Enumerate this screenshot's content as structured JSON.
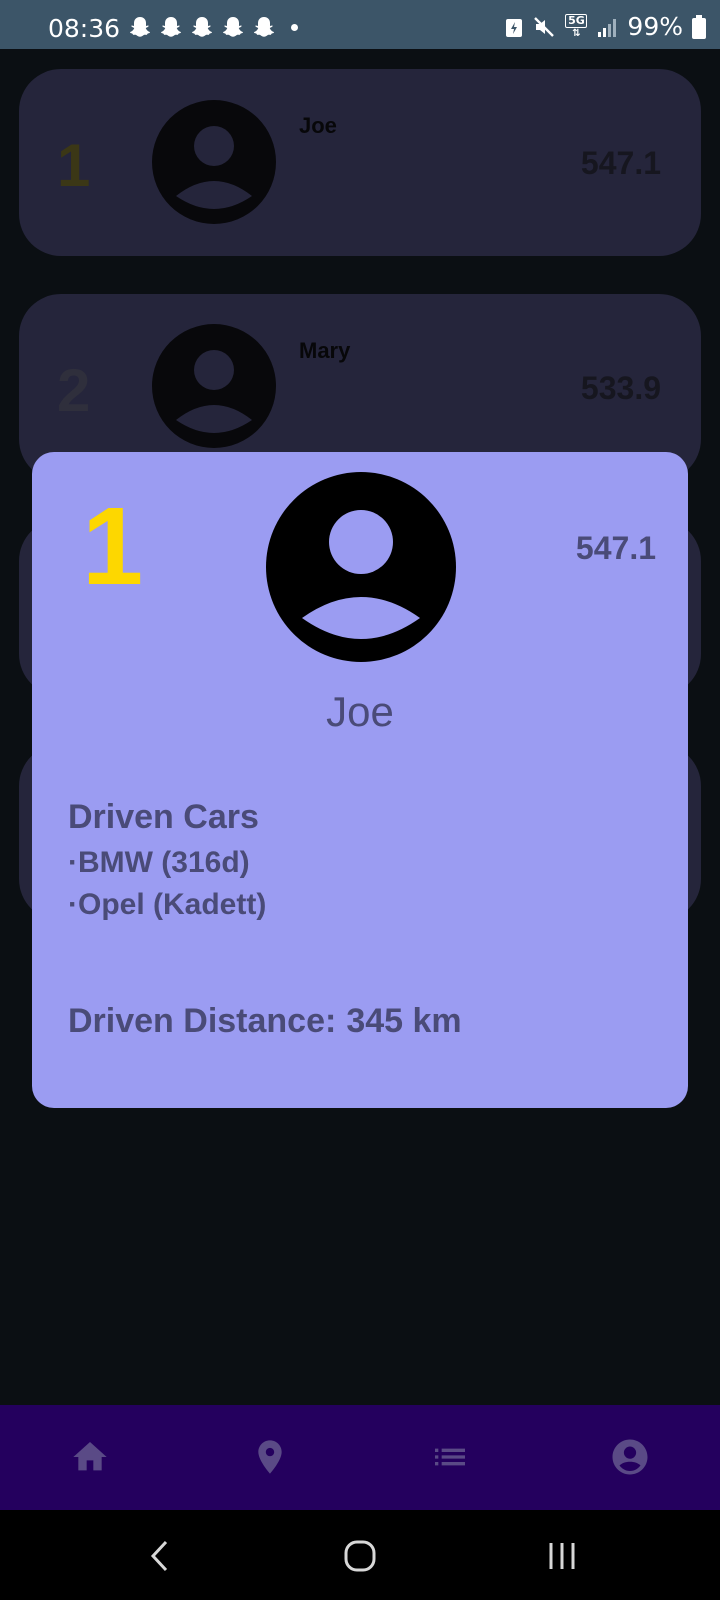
{
  "status_bar": {
    "time": "08:36",
    "notification_icons": [
      "snapchat-icon",
      "snapchat-icon",
      "snapchat-icon",
      "snapchat-icon",
      "snapchat-icon"
    ],
    "network": "5G",
    "battery": "99%"
  },
  "leaderboard": [
    {
      "rank": "1",
      "name": "Joe",
      "score": "547.1",
      "rank_color": "#3b3716"
    },
    {
      "rank": "2",
      "name": "Mary",
      "score": "533.9",
      "rank_color": "#2f2f3c"
    }
  ],
  "detail_dialog": {
    "rank": "1",
    "name": "Joe",
    "score": "547.1",
    "cars_title": "Driven Cars",
    "cars": [
      "·BMW (316d)",
      "·Opel (Kadett)"
    ],
    "distance_label": "Driven Distance:",
    "distance_value": "345 km"
  },
  "bottom_nav": {
    "items": [
      "home-icon",
      "location-pin-icon",
      "list-icon",
      "account-icon"
    ]
  },
  "colors": {
    "background": "#0b0f13",
    "card": "#25253b",
    "dialog": "#9b9cf2",
    "dialog_text": "#4a4b78",
    "rank_gold": "#fdd700",
    "bottom_nav": "#24005e",
    "nav_icon": "#5a4a86"
  }
}
